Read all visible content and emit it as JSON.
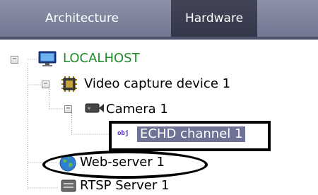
{
  "tabs": [
    {
      "label": "Architecture",
      "active": false
    },
    {
      "label": "Hardware",
      "active": true
    }
  ],
  "tree": {
    "localhost": {
      "label": "LOCALHOST",
      "icon": "monitor-icon",
      "color": "#1f8a2c"
    },
    "video_capture": {
      "label": "Video capture device 1",
      "icon": "chip-icon"
    },
    "camera": {
      "label": "Camera 1",
      "icon": "camera-icon"
    },
    "echd": {
      "label": "ECHD channel 1",
      "tag": "obj",
      "selected": true
    },
    "web_server": {
      "label": "Web-server 1",
      "icon": "globe-icon"
    },
    "rtsp_server": {
      "label": "RTSP Server 1",
      "icon": "server-icon"
    }
  },
  "colors": {
    "selection": "#6e7396",
    "tabbar": "#7a7f99",
    "active_tab": "#393c50"
  }
}
